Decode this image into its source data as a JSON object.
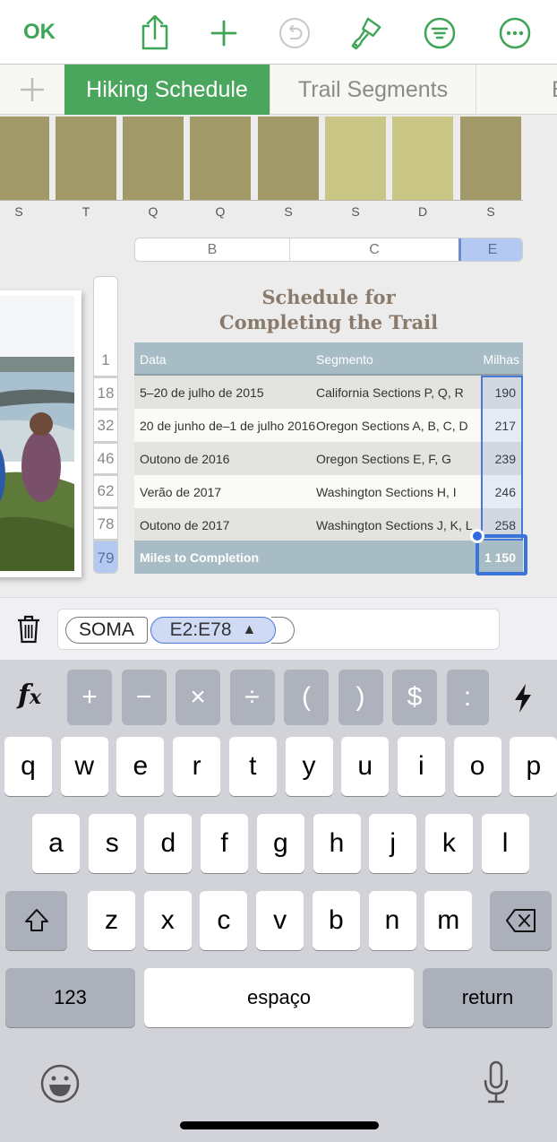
{
  "toolbar": {
    "ok_label": "OK",
    "icons": [
      "share-icon",
      "add-icon",
      "undo-icon",
      "format-brush-icon",
      "filter-icon",
      "more-icon"
    ],
    "accent_color": "#3fa556"
  },
  "tabs": [
    {
      "label": "Hiking Schedule",
      "active": true
    },
    {
      "label": "Trail Segments",
      "active": false
    },
    {
      "label": "E",
      "active": false
    }
  ],
  "chart": {
    "bar_labels": [
      "S",
      "T",
      "Q",
      "Q",
      "S",
      "S",
      "D",
      "S"
    ],
    "bar_tones": [
      "dark",
      "dark",
      "dark",
      "dark",
      "dark",
      "light",
      "light",
      "dark"
    ]
  },
  "column_headers": [
    "B",
    "C",
    "E"
  ],
  "row_headers": [
    "1",
    "18",
    "32",
    "46",
    "62",
    "78",
    "79"
  ],
  "table": {
    "title_line1": "Schedule for",
    "title_line2": "Completing the Trail",
    "headers": [
      "Data",
      "Segmento",
      "Milhas"
    ],
    "rows": [
      [
        "5–20 de julho de 2015",
        "California Sections P, Q, R",
        "190"
      ],
      [
        "20 de junho de–1 de julho 2016",
        "Oregon Sections A, B, C, D",
        "217"
      ],
      [
        "Outono de 2016",
        "Oregon Sections E, F, G",
        "239"
      ],
      [
        "Verão de 2017",
        "Washington Sections H, I",
        "246"
      ],
      [
        "Outono de 2017",
        "Washington Sections J, K, L",
        "258"
      ]
    ],
    "footer": {
      "label": "Miles to Completion",
      "value": "1 150"
    }
  },
  "formula": {
    "function": "SOMA",
    "range": "E2:E78",
    "range_arrow": "▲"
  },
  "keyboard": {
    "operators": [
      "+",
      "−",
      "×",
      "÷",
      "(",
      ")",
      "$",
      ":"
    ],
    "row1": [
      "q",
      "w",
      "e",
      "r",
      "t",
      "y",
      "u",
      "i",
      "o",
      "p"
    ],
    "row2": [
      "a",
      "s",
      "d",
      "f",
      "g",
      "h",
      "j",
      "k",
      "l"
    ],
    "row3": [
      "z",
      "x",
      "c",
      "v",
      "b",
      "n",
      "m"
    ],
    "numbers_label": "123",
    "space_label": "espaço",
    "return_label": "return"
  }
}
